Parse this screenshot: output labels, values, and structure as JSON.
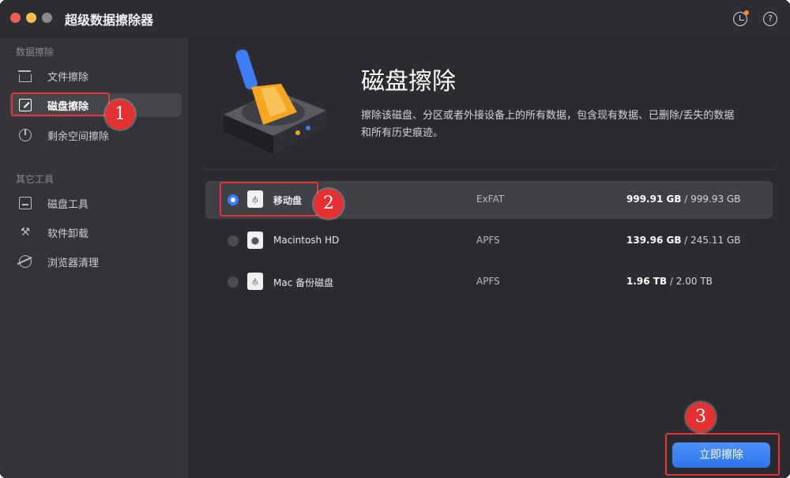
{
  "window": {
    "title": "超级数据擦除器"
  },
  "sidebar": {
    "section1_label": "数据擦除",
    "section2_label": "其它工具",
    "items": [
      {
        "label": "文件擦除",
        "icon": "file-shredder-icon",
        "active": false
      },
      {
        "label": "磁盘擦除",
        "icon": "disk-erase-icon",
        "active": true
      },
      {
        "label": "剩余空间擦除",
        "icon": "pie-chart-icon",
        "active": false
      },
      {
        "label": "磁盘工具",
        "icon": "disk-tool-icon",
        "active": false
      },
      {
        "label": "软件卸载",
        "icon": "uninstall-icon",
        "active": false
      },
      {
        "label": "浏览器清理",
        "icon": "browser-icon",
        "active": false
      }
    ]
  },
  "header": {
    "help_symbol": "?"
  },
  "main": {
    "title": "磁盘擦除",
    "description": "擦除该磁盘、分区或者外接设备上的所有数据，包含现有数据、已删除/丢失的数据和所有历史痕迹。",
    "disks": [
      {
        "name": "移动盘",
        "filesystem": "ExFAT",
        "used": "999.91 GB",
        "separator": " / ",
        "total": "999.93 GB",
        "selected": true,
        "icon": "usb-drive-icon"
      },
      {
        "name": "Macintosh HD",
        "filesystem": "APFS",
        "used": "139.96 GB",
        "separator": " / ",
        "total": "245.11 GB",
        "selected": false,
        "icon": "apple-drive-icon"
      },
      {
        "name": "Mac 备份磁盘",
        "filesystem": "APFS",
        "used": "1.96 TB",
        "separator": " / ",
        "total": "2.00 TB",
        "selected": false,
        "icon": "usb-drive-icon"
      }
    ],
    "erase_button": "立即擦除"
  },
  "annotations": [
    "1",
    "2",
    "3"
  ],
  "colors": {
    "accent": "#3d7cf5",
    "highlight": "#e43636",
    "background": "#2b2b31",
    "sidebar": "#333339"
  }
}
